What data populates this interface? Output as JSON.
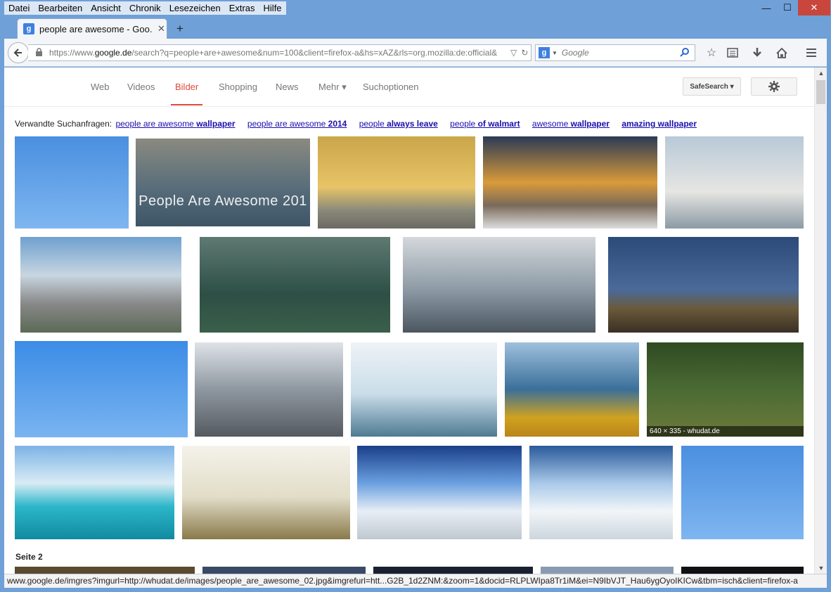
{
  "menu": [
    {
      "label": "Datei"
    },
    {
      "label": "Bearbeiten"
    },
    {
      "label": "Ansicht"
    },
    {
      "label": "Chronik"
    },
    {
      "label": "Lesezeichen"
    },
    {
      "label": "Extras"
    },
    {
      "label": "Hilfe"
    }
  ],
  "window_controls": {
    "minimize": "—",
    "maximize": "☐",
    "close": "✕"
  },
  "tab": {
    "favicon": "g",
    "title": "people are awesome - Goo...",
    "close": "✕",
    "new_tab": "+"
  },
  "url": {
    "prefix": "https://www.",
    "host": "google.de",
    "path": "/search?q=people+are+awesome&num=100&client=firefox-a&hs=xAZ&rls=org.mozilla:de:official&"
  },
  "searchbar": {
    "engine_icon": "g",
    "placeholder": "Google"
  },
  "google_nav": {
    "tabs": [
      {
        "label": "Web"
      },
      {
        "label": "Videos"
      },
      {
        "label": "Bilder"
      },
      {
        "label": "Shopping"
      },
      {
        "label": "News"
      },
      {
        "label": "Mehr ▾"
      },
      {
        "label": "Suchoptionen"
      }
    ],
    "active_tab": "Bilder",
    "safesearch": "SafeSearch ▾"
  },
  "related": {
    "label": "Verwandte Suchanfragen:",
    "items": [
      {
        "plain": "people are awesome",
        "bold": "wallpaper"
      },
      {
        "plain": "people are awesome",
        "bold": "2014"
      },
      {
        "plain": "people",
        "bold": "always leave"
      },
      {
        "plain": "people",
        "bold": "of walmart"
      },
      {
        "plain": "awesome",
        "bold": "wallpaper"
      },
      {
        "plain": "",
        "bold": "amazing wallpaper"
      }
    ]
  },
  "images": [
    {
      "name": "image-snowmobile-stunt",
      "caption": ""
    },
    {
      "name": "image-cliff-jump",
      "caption": "",
      "overlay": "People Are Awesome 201"
    },
    {
      "name": "image-ski-jump-sunset",
      "caption": ""
    },
    {
      "name": "image-backflip-santorini",
      "caption": ""
    },
    {
      "name": "image-jump-clouds",
      "caption": ""
    },
    {
      "name": "image-highline-yosemite",
      "caption": ""
    },
    {
      "name": "image-wingsuit-flight",
      "caption": ""
    },
    {
      "name": "image-base-jump-cliff",
      "caption": ""
    },
    {
      "name": "image-bmx-ramp",
      "caption": ""
    },
    {
      "name": "image-snowmobile-stunt-2",
      "caption": ""
    },
    {
      "name": "image-car-two-wheels",
      "caption": ""
    },
    {
      "name": "image-flyboard",
      "caption": ""
    },
    {
      "name": "image-bridge-climb",
      "caption": ""
    },
    {
      "name": "image-dirtbike-forest",
      "caption": "640 × 335 - whudat.de"
    },
    {
      "name": "image-sea-dive",
      "caption": ""
    },
    {
      "name": "image-bmx-field",
      "caption": ""
    },
    {
      "name": "image-ski-sun",
      "caption": ""
    },
    {
      "name": "image-snowboard",
      "caption": ""
    },
    {
      "name": "image-snowmobile-stunt-3",
      "caption": ""
    },
    {
      "name": "image-page2-a",
      "caption": ""
    },
    {
      "name": "image-page2-b",
      "caption": ""
    },
    {
      "name": "image-page2-c",
      "caption": ""
    },
    {
      "name": "image-page2-d",
      "caption": ""
    },
    {
      "name": "image-page2-e",
      "caption": ""
    }
  ],
  "page2_label": "Seite 2",
  "status_url": "www.google.de/imgres?imgurl=http://whudat.de/images/people_are_awesome_02.jpg&imgrefurl=htt...G2B_1d2ZNM:&zoom=1&docid=RLPLWIpa8Tr1iM&ei=N9IbVJT_Hau6ygOyoIKICw&tbm=isch&client=firefox-a"
}
